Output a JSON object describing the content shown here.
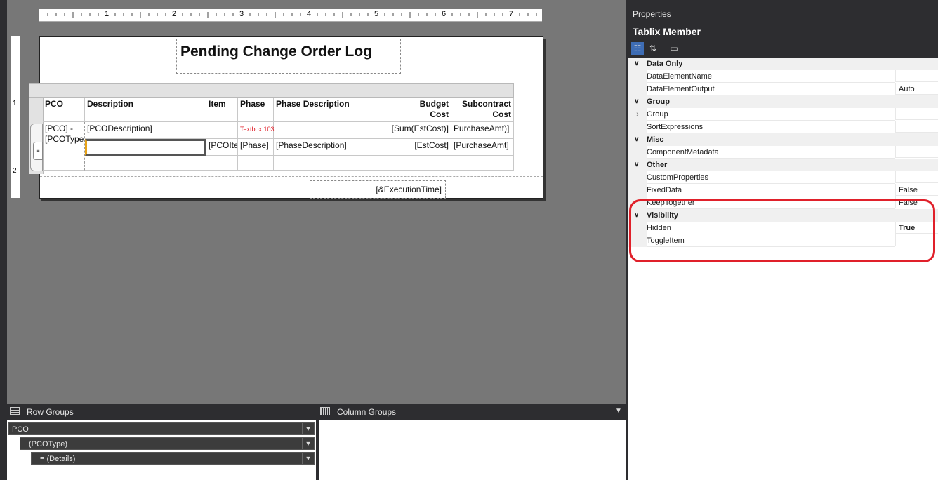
{
  "report": {
    "title": "Pending Change Order Log",
    "ruler_numbers": [
      "1",
      "2",
      "3",
      "4",
      "5",
      "6",
      "7"
    ],
    "vruler_numbers": [
      "1",
      "2"
    ],
    "table": {
      "headers": [
        "PCO",
        "Description",
        "Item",
        "Phase",
        "Phase Description",
        "Budget\nCost",
        "Subcontract\nCost"
      ],
      "header_line1": [
        "PCO",
        "Description",
        "Item",
        "Phase",
        "Phase Description",
        "Budget",
        "Subcontract"
      ],
      "header_line2": [
        "",
        "",
        "",
        "",
        "",
        "Cost",
        "Cost"
      ],
      "group_cell": [
        "[PCO] -",
        "[PCOType"
      ],
      "row1": [
        "[PCODescription]",
        "",
        "Textbox 103",
        "",
        "[Sum(EstCost)]",
        "PurchaseAmt)]"
      ],
      "row2": [
        "",
        "[PCOIte",
        "[Phase]",
        "[PhaseDescription]",
        "[EstCost]",
        "[PurchaseAmt]"
      ]
    },
    "footer": "[&ExecutionTime]"
  },
  "groups": {
    "row_title": "Row Groups",
    "column_title": "Column Groups",
    "row_groups": [
      "PCO",
      "(PCOType)",
      "(Details)"
    ]
  },
  "properties": {
    "panel_title": "Properties",
    "object_name": "Tablix Member",
    "rows": [
      {
        "type": "cat",
        "label": "Data Only"
      },
      {
        "type": "prop",
        "name": "DataElementName",
        "value": ""
      },
      {
        "type": "prop",
        "name": "DataElementOutput",
        "value": "Auto"
      },
      {
        "type": "cat",
        "label": "Group"
      },
      {
        "type": "prop",
        "name": "Group",
        "value": "",
        "expandable": true
      },
      {
        "type": "prop",
        "name": "SortExpressions",
        "value": ""
      },
      {
        "type": "cat",
        "label": "Misc"
      },
      {
        "type": "prop",
        "name": "ComponentMetadata",
        "value": ""
      },
      {
        "type": "cat",
        "label": "Other"
      },
      {
        "type": "prop",
        "name": "CustomProperties",
        "value": ""
      },
      {
        "type": "prop",
        "name": "FixedData",
        "value": "False"
      },
      {
        "type": "prop",
        "name": "KeepTogether",
        "value": "False"
      },
      {
        "type": "cat",
        "label": "Visibility"
      },
      {
        "type": "prop",
        "name": "Hidden",
        "value": "True",
        "bold": true
      },
      {
        "type": "prop",
        "name": "ToggleItem",
        "value": ""
      }
    ]
  },
  "colors": {
    "highlight": "#e0202a",
    "textbox_red": "#e0202a",
    "selection": "#e8a317"
  }
}
